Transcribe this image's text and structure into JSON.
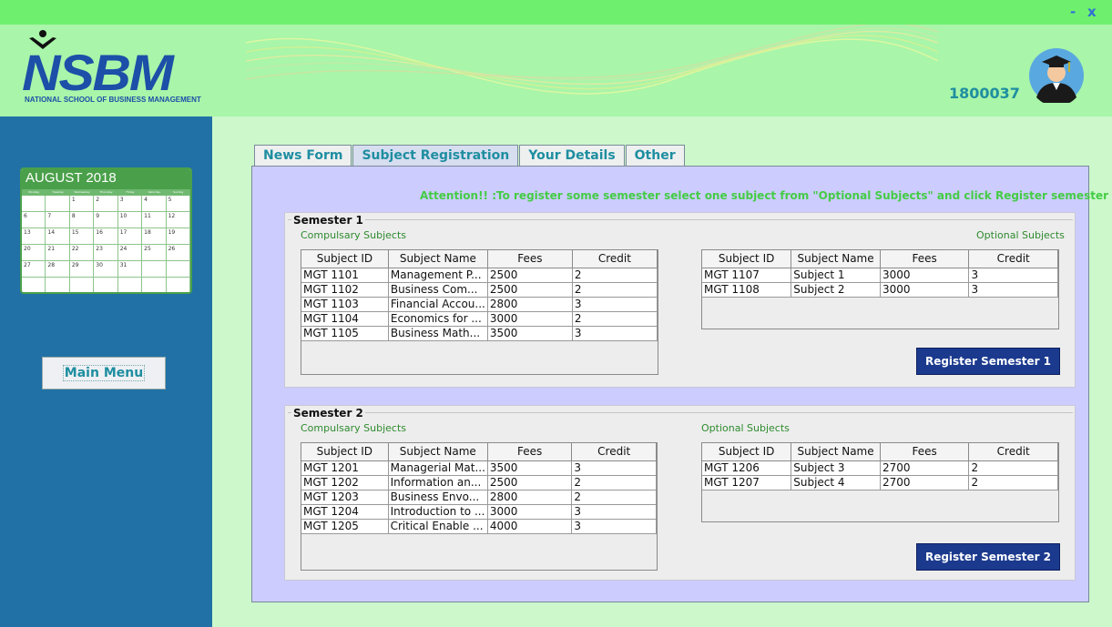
{
  "window": {
    "minimize": "-",
    "close": "x"
  },
  "header": {
    "logo_text": "NSBM",
    "logo_subtitle": "NATIONAL SCHOOL OF BUSINESS MANAGEMENT",
    "user_id": "1800037",
    "avatar_icon": "graduate-avatar-icon"
  },
  "sidebar": {
    "calendar": {
      "title": "AUGUST 2018",
      "day_names": [
        "Monday",
        "Tuesday",
        "Wednesday",
        "Thursday",
        "Friday",
        "Saturday",
        "Sunday"
      ],
      "cells": [
        "",
        "",
        "1",
        "2",
        "3",
        "4",
        "5",
        "6",
        "7",
        "8",
        "9",
        "10",
        "11",
        "12",
        "13",
        "14",
        "15",
        "16",
        "17",
        "18",
        "19",
        "20",
        "21",
        "22",
        "23",
        "24",
        "25",
        "26",
        "27",
        "28",
        "29",
        "30",
        "31",
        "",
        "",
        "",
        "",
        "",
        "",
        "",
        "",
        ""
      ]
    },
    "main_menu_label": "Main Menu"
  },
  "tabs": [
    {
      "label": "News Form",
      "active": false
    },
    {
      "label": "Subject Registration",
      "active": true
    },
    {
      "label": "Your Details",
      "active": false
    },
    {
      "label": "Other",
      "active": false
    }
  ],
  "attention": "Attention!! :To register some semester select one subject from \"Optional Subjects\" and click Register semester button",
  "columns": [
    "Subject ID",
    "Subject Name",
    "Fees",
    "Credit"
  ],
  "semester1": {
    "title": "Semester 1",
    "compulsory_label": "Compulsary Subjects",
    "optional_label": "Optional Subjects",
    "compulsory_rows": [
      [
        "MGT 1101",
        "Management P...",
        "2500",
        "2"
      ],
      [
        "MGT 1102",
        "Business Com...",
        "2500",
        "2"
      ],
      [
        "MGT 1103",
        "Financial Accou...",
        "2800",
        "3"
      ],
      [
        "MGT 1104",
        "Economics for ...",
        "3000",
        "2"
      ],
      [
        "MGT 1105",
        "Business Math...",
        "3500",
        "3"
      ]
    ],
    "optional_rows": [
      [
        "MGT 1107",
        "Subject 1",
        "3000",
        "3"
      ],
      [
        "MGT 1108",
        "Subject 2",
        "3000",
        "3"
      ]
    ],
    "register_label": "Register Semester 1"
  },
  "semester2": {
    "title": "Semester 2",
    "compulsory_label": "Compulsary Subjects",
    "optional_label": "Optional Subjects",
    "compulsory_rows": [
      [
        "MGT 1201",
        "Managerial Mat...",
        "3500",
        "3"
      ],
      [
        "MGT 1202",
        "Information an...",
        "2500",
        "2"
      ],
      [
        "MGT 1203",
        "Business Envo...",
        "2800",
        "2"
      ],
      [
        "MGT 1204",
        "Introduction to ...",
        "3000",
        "3"
      ],
      [
        "MGT 1205",
        "Critical Enable ...",
        "4000",
        "3"
      ]
    ],
    "optional_rows": [
      [
        "MGT 1206",
        "Subject 3",
        "2700",
        "2"
      ],
      [
        "MGT 1207",
        "Subject 4",
        "2700",
        "2"
      ]
    ],
    "register_label": "Register Semester 2"
  },
  "colors": {
    "titlebar": "#6ef06e",
    "header": "#a9f5a9",
    "sidebar": "#2171a6",
    "panel": "#ccccff",
    "accent_text": "#1e8ea0",
    "register_button": "#1b3a8e"
  }
}
